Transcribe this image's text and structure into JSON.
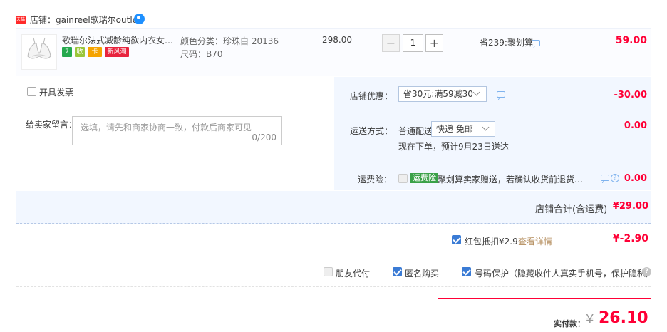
{
  "shop": {
    "badge_text": "天猫",
    "label": "店铺：gainreel歌瑞尔outlet",
    "contact_icon": "wangwang-icon"
  },
  "item": {
    "title": "歌瑞尔法式减龄纯欲内衣女轻盈...",
    "tags": [
      "7",
      "收",
      "卡",
      "新风潮"
    ],
    "sku_color": "颜色分类：珍珠白 20136",
    "sku_size": "尺码：B70",
    "price": "298.00",
    "quantity": "1",
    "minus": "−",
    "plus": "+",
    "promo": "省239:聚划算",
    "total": "59.00"
  },
  "invoice": {
    "label": "开具发票",
    "checked": false
  },
  "message": {
    "label": "给卖家留言：",
    "placeholder": "选填，请先和商家协商一致，付款后商家可见",
    "count": "0/200"
  },
  "discount": {
    "label": "店铺优惠：",
    "selected": "省30元:满59减30",
    "amount": "-30.00"
  },
  "shipping": {
    "label": "运送方式：",
    "type": "普通配送",
    "selected": "快递 免邮",
    "eta": "现在下单，预计9月23日送达",
    "amount": "0.00"
  },
  "insurance": {
    "label": "运费险：",
    "badge": "运费险",
    "desc": "聚划算卖家赠送，若确认收货前退货，可获...",
    "amount": "0.00"
  },
  "shop_total": {
    "label": "店铺合计(含运费)",
    "amount": "¥29.00"
  },
  "red_packet": {
    "label": "红包抵扣¥2.9",
    "link": "查看详情",
    "amount": "¥-2.90",
    "checked": true
  },
  "options": {
    "friend_pay": "朋友代付",
    "anonymous": "匿名购买",
    "number_protect": "号码保护（隐藏收件人真实手机号，保护隐私）"
  },
  "payment": {
    "label": "实付款：",
    "currency": "¥",
    "amount": "26.10"
  },
  "colors": {
    "accent": "#ff0036",
    "blue": "#3a7bd5",
    "panel": "#f2f7ff"
  }
}
